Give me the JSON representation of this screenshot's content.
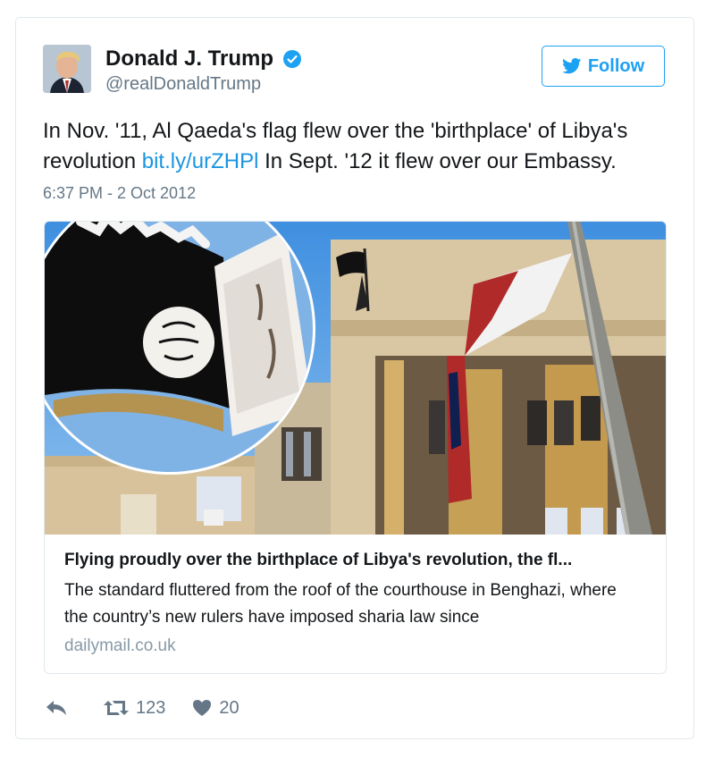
{
  "author": {
    "display_name": "Donald J. Trump",
    "handle": "@realDonaldTrump",
    "verified": true
  },
  "follow_button": {
    "label": "Follow",
    "icon": "twitter-bird-icon"
  },
  "tweet": {
    "text_before_link": "In Nov. '11, Al Qaeda's flag flew over the 'birthplace' of Libya's revolution ",
    "link_text": "bit.ly/urZHPl",
    "text_after_link": " In Sept. '12 it flew over our Embassy.",
    "timestamp": "6:37 PM - 2 Oct 2012"
  },
  "card": {
    "title": "Flying proudly over the birthplace of Libya's revolution, the fl...",
    "description": "The standard fluttered from the roof of the courthouse in Benghazi, where the country’s new rulers have imposed sharia law since",
    "domain": "dailymail.co.uk",
    "flag_script_top": "ﻻ إله إلا الله",
    "flag_seal_text": "الله رسول محمد"
  },
  "actions": {
    "reply_icon": "reply-icon",
    "retweet_icon": "retweet-icon",
    "retweet_count": "123",
    "like_icon": "heart-icon",
    "like_count": "20"
  },
  "colors": {
    "accent": "#1da1f2",
    "link": "#1b95e0",
    "muted": "#657786",
    "border": "#e1e8ed"
  }
}
